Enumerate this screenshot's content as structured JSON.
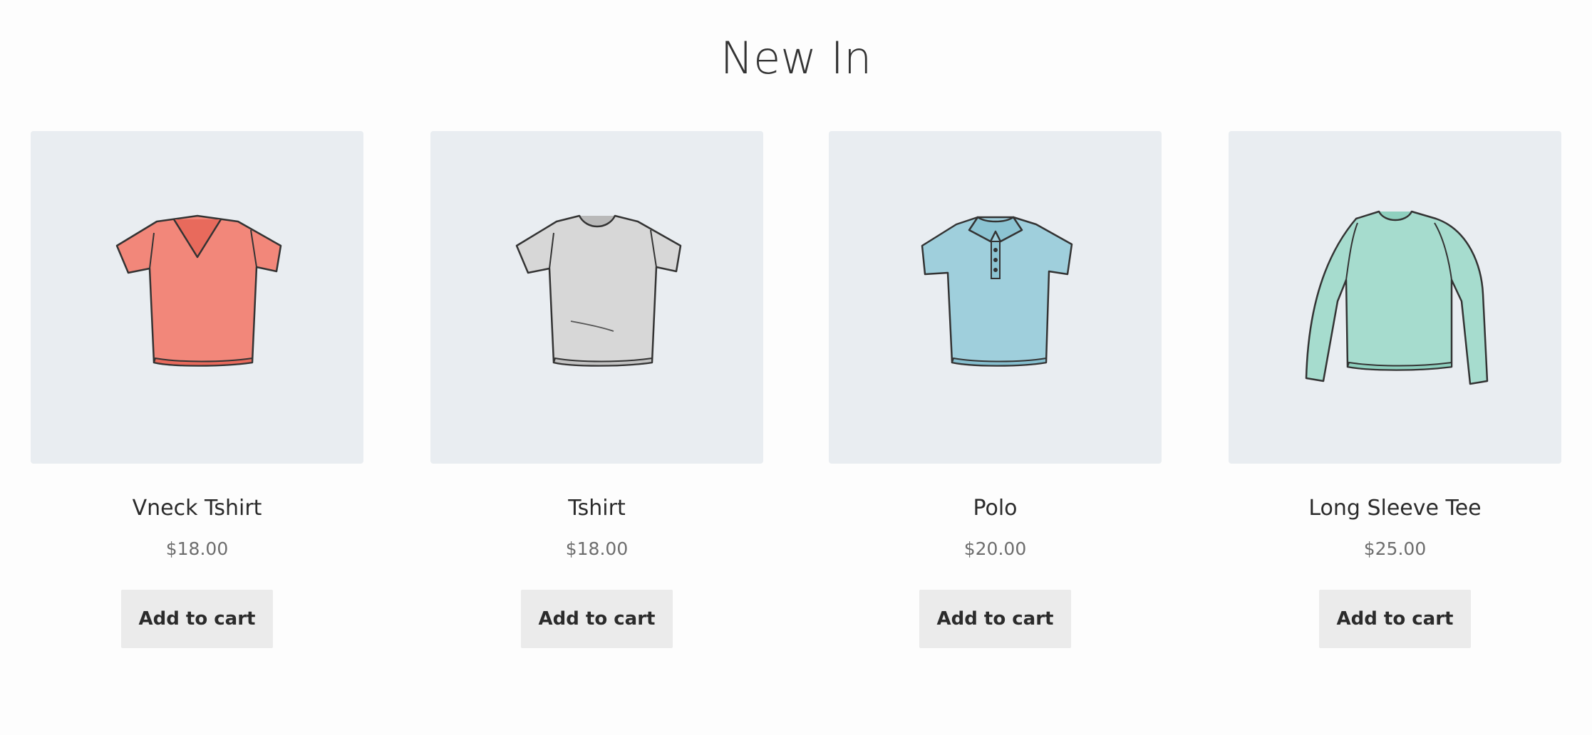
{
  "section": {
    "title": "New In"
  },
  "products": [
    {
      "title": "Vneck Tshirt",
      "price": "$18.00",
      "button_label": "Add to cart",
      "image_icon": "vneck-tshirt-icon",
      "color": "#f2877a"
    },
    {
      "title": "Tshirt",
      "price": "$18.00",
      "button_label": "Add to cart",
      "image_icon": "tshirt-icon",
      "color": "#d7d7d7"
    },
    {
      "title": "Polo",
      "price": "$20.00",
      "button_label": "Add to cart",
      "image_icon": "polo-shirt-icon",
      "color": "#9fcfdc"
    },
    {
      "title": "Long Sleeve Tee",
      "price": "$25.00",
      "button_label": "Add to cart",
      "image_icon": "long-sleeve-tee-icon",
      "color": "#a6dcce"
    }
  ],
  "colors": {
    "background": "#fdfdfd",
    "image_background": "#e9edf1",
    "button_background": "#ebebeb",
    "text": "#2b2b2b",
    "price_text": "#6d6d6d"
  }
}
